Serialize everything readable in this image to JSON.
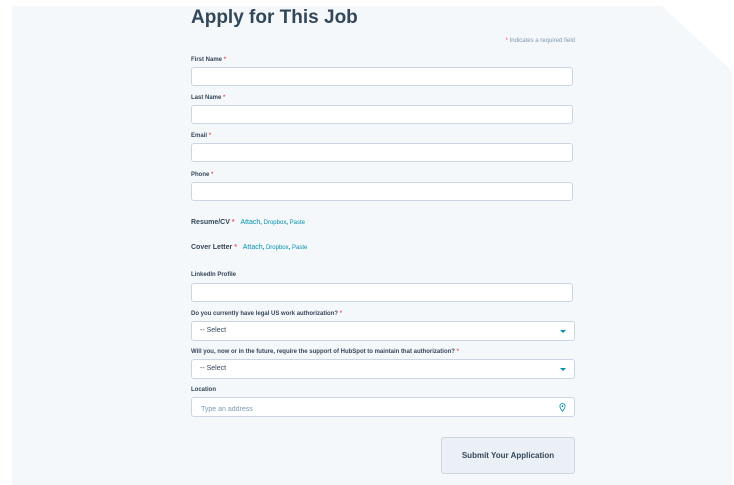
{
  "form": {
    "title": "Apply for This Job",
    "required_note": "Indicates a required field",
    "required_mark": "*",
    "fields": {
      "first_name": {
        "label": "First Name",
        "value": ""
      },
      "last_name": {
        "label": "Last Name",
        "value": ""
      },
      "email": {
        "label": "Email",
        "value": ""
      },
      "phone": {
        "label": "Phone",
        "value": ""
      },
      "linkedin": {
        "label": "LinkedIn Profile",
        "value": ""
      },
      "location": {
        "label": "Location",
        "placeholder": "Type an address",
        "icon": "map-pin-icon"
      }
    },
    "uploads": {
      "resume": {
        "label": "Resume/CV",
        "attach": "Attach",
        "dropbox": "Dropbox",
        "paste": "Paste"
      },
      "cover_letter": {
        "label": "Cover Letter",
        "attach": "Attach",
        "dropbox": "Dropbox",
        "paste": "Paste"
      }
    },
    "questions": {
      "work_auth": {
        "label": "Do you currently have legal US work authorization?",
        "selected": "-- Select"
      },
      "sponsorship": {
        "label": "Will you, now or in the future, require the support of HubSpot to maintain that authorization?",
        "selected": "-- Select"
      }
    },
    "submit_label": "Submit Your Application"
  },
  "colors": {
    "accent": "#0091ae",
    "required": "#f2545b",
    "text": "#33475b",
    "panel": "#f5f8fa",
    "border": "#cbd6e2"
  }
}
